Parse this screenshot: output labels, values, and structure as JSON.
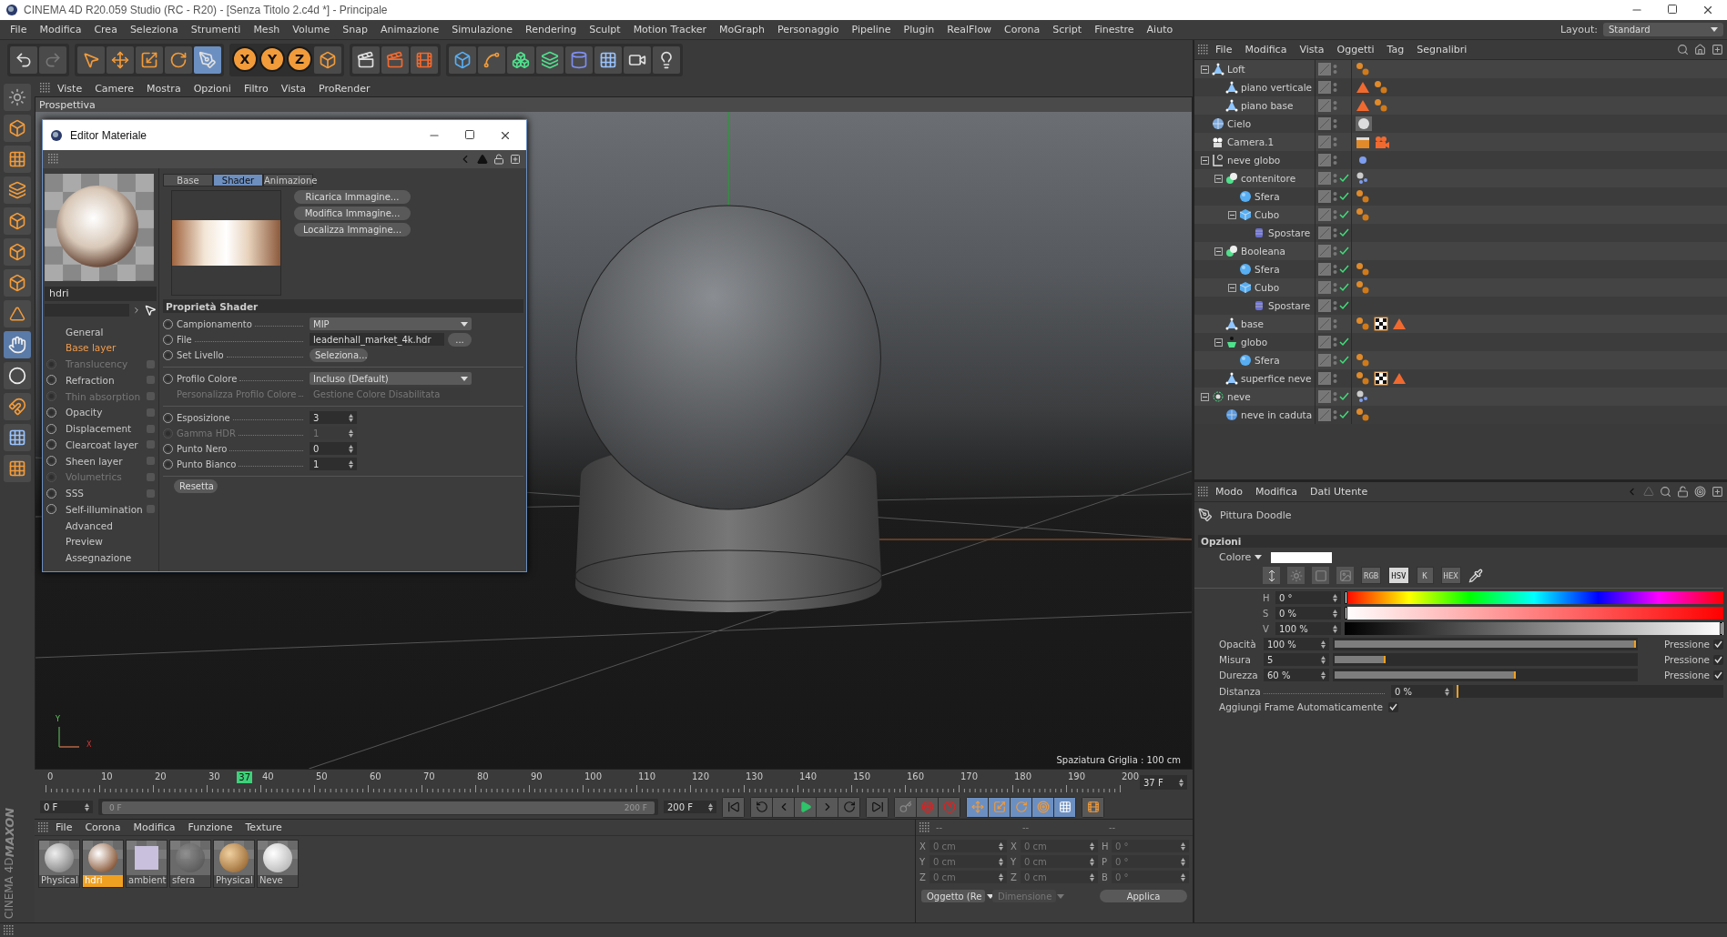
{
  "window": {
    "title": "CINEMA 4D R20.059 Studio (RC - R20) - [Senza Titolo 2.c4d *] - Principale"
  },
  "menu": [
    "File",
    "Modifica",
    "Crea",
    "Seleziona",
    "Strumenti",
    "Mesh",
    "Volume",
    "Snap",
    "Animazione",
    "Simulazione",
    "Rendering",
    "Sculpt",
    "Motion Tracker",
    "MoGraph",
    "Personaggio",
    "Pipeline",
    "Plugin",
    "RealFlow",
    "Corona",
    "Script",
    "Finestre",
    "Aiuto"
  ],
  "layout": {
    "label": "Layout:",
    "value": "Standard"
  },
  "axis_lock": [
    {
      "label": "X",
      "on": true
    },
    {
      "label": "Y",
      "on": true
    },
    {
      "label": "Z",
      "on": true
    }
  ],
  "viewport": {
    "menu": [
      "Viste",
      "Camere",
      "Mostra",
      "Opzioni",
      "Filtro",
      "Vista",
      "ProRender"
    ],
    "view_name": "Prospettiva",
    "grid_spacing": "Spaziatura Griglia : 100 cm",
    "axes": [
      "Y",
      "X"
    ]
  },
  "material_editor": {
    "title": "Editor Materiale",
    "material_name": "hdri",
    "channels": [
      {
        "label": "General",
        "kind": "section",
        "selected": false
      },
      {
        "label": "Base layer",
        "kind": "section",
        "selected": true
      },
      {
        "label": "Translucency",
        "kind": "layer",
        "enabled": false,
        "selected": false
      },
      {
        "label": "Refraction",
        "kind": "layer",
        "enabled": true,
        "selected": false
      },
      {
        "label": "Thin absorption",
        "kind": "layer",
        "enabled": false,
        "selected": false
      },
      {
        "label": "Opacity",
        "kind": "layer",
        "enabled": true,
        "selected": false
      },
      {
        "label": "Displacement",
        "kind": "layer",
        "enabled": true,
        "selected": false
      },
      {
        "label": "Clearcoat layer",
        "kind": "layer",
        "enabled": true,
        "selected": false
      },
      {
        "label": "Sheen layer",
        "kind": "layer",
        "enabled": true,
        "selected": false
      },
      {
        "label": "Volumetrics",
        "kind": "layer",
        "enabled": false,
        "selected": false
      },
      {
        "label": "SSS",
        "kind": "layer",
        "enabled": true,
        "selected": false
      },
      {
        "label": "Self-illumination",
        "kind": "layer",
        "enabled": true,
        "selected": false
      },
      {
        "label": "Advanced",
        "kind": "section",
        "selected": false
      },
      {
        "label": "Preview",
        "kind": "section",
        "selected": false
      },
      {
        "label": "Assegnazione",
        "kind": "section",
        "selected": false
      }
    ],
    "tabs": [
      {
        "label": "Base",
        "selected": false
      },
      {
        "label": "Shader",
        "selected": true
      },
      {
        "label": "Animazione",
        "selected": false
      }
    ],
    "image_buttons": [
      "Ricarica Immagine...",
      "Modifica Immagine...",
      "Localizza Immagine..."
    ],
    "section": "Proprietà Shader",
    "param_groups": [
      [
        {
          "label": "Campionamento",
          "kind": "dropdown",
          "value": "MIP",
          "disabled": false
        },
        {
          "label": "File",
          "kind": "file",
          "value": "leadenhall_market_4k.hdr",
          "button": "...",
          "disabled": false
        },
        {
          "label": "Set Livello",
          "kind": "button",
          "value": "Seleziona...",
          "disabled": false
        }
      ],
      [
        {
          "label": "Profilo Colore",
          "kind": "dropdown",
          "value": "Incluso (Default)",
          "disabled": false
        },
        {
          "label": "Personalizza Profilo Colore",
          "kind": "text",
          "value": "Gestione Colore Disabilitata",
          "disabled": true
        }
      ],
      [
        {
          "label": "Esposizione",
          "kind": "number",
          "value": "3",
          "disabled": false
        },
        {
          "label": "Gamma HDR",
          "kind": "number",
          "value": "1",
          "disabled": true
        },
        {
          "label": "Punto Nero",
          "kind": "number",
          "value": "0",
          "disabled": false
        },
        {
          "label": "Punto Bianco",
          "kind": "number",
          "value": "1",
          "disabled": false
        }
      ]
    ],
    "reset": "Resetta"
  },
  "object_manager": {
    "menu": [
      "File",
      "Modifica",
      "Vista",
      "Oggetti",
      "Tag",
      "Segnalibri"
    ],
    "objects": [
      {
        "name": "Loft",
        "kind": "polygon",
        "checked": false,
        "expanded": true,
        "tags": [
          {
            "kind": "phong"
          }
        ],
        "children": [
          {
            "name": "piano verticale",
            "kind": "polygon",
            "checked": false,
            "tags": [
              {
                "kind": "selection"
              },
              {
                "kind": "phong"
              }
            ]
          },
          {
            "name": "piano base",
            "kind": "polygon",
            "checked": false,
            "tags": [
              {
                "kind": "selection"
              },
              {
                "kind": "phong"
              }
            ]
          }
        ]
      },
      {
        "name": "Cielo",
        "kind": "sky",
        "checked": false,
        "tags": [
          {
            "kind": "material"
          }
        ]
      },
      {
        "name": "Camera.1",
        "kind": "camera",
        "checked": false,
        "tags": [
          {
            "kind": "clapper"
          },
          {
            "kind": "camera"
          }
        ]
      },
      {
        "name": "neve globo",
        "kind": "null",
        "checked": false,
        "expanded": true,
        "tags": [
          {
            "kind": "blue-dot"
          }
        ],
        "children": [
          {
            "name": "contenitore",
            "kind": "boole",
            "checked": true,
            "expanded": true,
            "tags": [
              {
                "kind": "particle"
              }
            ],
            "children": [
              {
                "name": "Sfera",
                "kind": "sphere",
                "checked": true,
                "tags": [
                  {
                    "kind": "phong"
                  }
                ]
              },
              {
                "name": "Cubo",
                "kind": "cube",
                "checked": true,
                "expanded": true,
                "tags": [
                  {
                    "kind": "phong"
                  }
                ],
                "children": [
                  {
                    "name": "Spostare",
                    "kind": "deformer",
                    "checked": true
                  }
                ]
              }
            ]
          },
          {
            "name": "Booleana",
            "kind": "boole",
            "checked": true,
            "expanded": true,
            "children": [
              {
                "name": "Sfera",
                "kind": "sphere",
                "checked": true,
                "tags": [
                  {
                    "kind": "phong"
                  }
                ]
              },
              {
                "name": "Cubo",
                "kind": "cube",
                "checked": true,
                "expanded": true,
                "tags": [
                  {
                    "kind": "phong"
                  }
                ],
                "children": [
                  {
                    "name": "Spostare",
                    "kind": "deformer",
                    "checked": true
                  }
                ]
              }
            ]
          },
          {
            "name": "base",
            "kind": "polygon",
            "checked": false,
            "tags": [
              {
                "kind": "phong"
              },
              {
                "kind": "checker"
              },
              {
                "kind": "selection"
              }
            ]
          },
          {
            "name": "globo",
            "kind": "connect",
            "checked": true,
            "expanded": true,
            "children": [
              {
                "name": "Sfera",
                "kind": "sphere",
                "checked": true,
                "tags": [
                  {
                    "kind": "phong"
                  }
                ]
              }
            ]
          },
          {
            "name": "superfice neve",
            "kind": "polygon",
            "checked": false,
            "tags": [
              {
                "kind": "phong"
              },
              {
                "kind": "checker"
              },
              {
                "kind": "selection"
              }
            ]
          }
        ]
      },
      {
        "name": "neve",
        "kind": "emitter",
        "checked": true,
        "expanded": true,
        "tags": [
          {
            "kind": "particle"
          }
        ],
        "children": [
          {
            "name": "neve in caduta",
            "kind": "particles",
            "checked": true,
            "tags": [
              {
                "kind": "phong"
              }
            ]
          }
        ]
      }
    ]
  },
  "attributes": {
    "menu": [
      "Modo",
      "Modifica",
      "Dati Utente"
    ],
    "tool": "Pittura Doodle",
    "section": "Opzioni",
    "color_label": "Colore",
    "color": "#ffffff",
    "color_modes": [
      {
        "label": "RGB",
        "selected": false
      },
      {
        "label": "HSV",
        "selected": true
      },
      {
        "label": "K",
        "selected": false
      },
      {
        "label": "HEX",
        "selected": false
      }
    ],
    "hsv": [
      {
        "label": "H",
        "value": "0 °",
        "level": 0,
        "kind": "hue"
      },
      {
        "label": "S",
        "value": "0 %",
        "level": 0,
        "kind": "saturation"
      },
      {
        "label": "V",
        "value": "100 %",
        "level": 1,
        "kind": "value"
      }
    ],
    "sliders": [
      {
        "label": "Opacità",
        "value": "100 %",
        "level": 1,
        "pressure": "Pressione",
        "pressure_checked": true
      },
      {
        "label": "Misura",
        "value": "5",
        "level": 0.17,
        "pressure": "Pressione",
        "pressure_checked": true
      },
      {
        "label": "Durezza",
        "value": "60 %",
        "level": 0.6,
        "pressure": "Pressione",
        "pressure_checked": true
      }
    ],
    "distance": {
      "label": "Distanza",
      "value": "0 %",
      "level": 0
    },
    "auto_frame": {
      "label": "Aggiungi Frame Automaticamente",
      "checked": true
    }
  },
  "timeline": {
    "ticks": [
      "0",
      "10",
      "20",
      "30",
      "40",
      "50",
      "60",
      "70",
      "80",
      "90",
      "100",
      "110",
      "120",
      "130",
      "140",
      "150",
      "160",
      "170",
      "180",
      "190",
      "200"
    ],
    "current_frame": "37",
    "level": 0.185,
    "current_field": "37 F",
    "start_field": "0 F",
    "range": {
      "start": "0 F",
      "end": "200 F",
      "level": 1
    },
    "end_field": "200 F"
  },
  "material_manager": {
    "menu": [
      "File",
      "Corona",
      "Modifica",
      "Funzione",
      "Texture"
    ],
    "materials": [
      {
        "name": "Physical",
        "kind": "matte",
        "selected": false
      },
      {
        "name": "hdri",
        "kind": "chrome",
        "selected": true
      },
      {
        "name": "ambient",
        "kind": "flat",
        "selected": false
      },
      {
        "name": "sfera",
        "kind": "glass",
        "selected": false
      },
      {
        "name": "Physical",
        "kind": "wood",
        "selected": false
      },
      {
        "name": "Neve",
        "kind": "snow",
        "selected": false
      }
    ]
  },
  "coordinates": {
    "headers": [
      "--",
      "--",
      "--"
    ],
    "rows": [
      [
        {
          "axis": "X",
          "value": "0 cm"
        },
        {
          "axis": "X",
          "value": "0 cm"
        },
        {
          "axis": "H",
          "value": "0 °"
        }
      ],
      [
        {
          "axis": "Y",
          "value": "0 cm"
        },
        {
          "axis": "Y",
          "value": "0 cm"
        },
        {
          "axis": "P",
          "value": "0 °"
        }
      ],
      [
        {
          "axis": "Z",
          "value": "0 cm"
        },
        {
          "axis": "Z",
          "value": "0 cm"
        },
        {
          "axis": "B",
          "value": "0 °"
        }
      ]
    ],
    "mode": {
      "value": "Oggetto (Re",
      "disabled": false
    },
    "size_mode": {
      "value": "Dimensione",
      "disabled": true
    },
    "apply": "Applica"
  },
  "logo": [
    "MAXON",
    "CINEMA 4D"
  ]
}
